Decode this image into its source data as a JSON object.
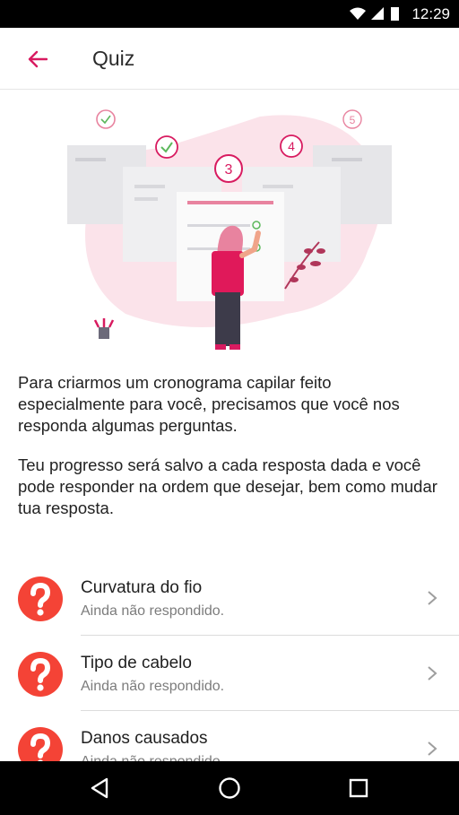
{
  "status_bar": {
    "time": "12:29"
  },
  "app_bar": {
    "title": "Quiz"
  },
  "hero": {
    "step_current": "3",
    "step_next": "4",
    "step_last": "5"
  },
  "intro": {
    "paragraph_1": "Para criarmos um cronograma capilar feito especialmente para você, precisamos que você nos responda algumas perguntas.",
    "paragraph_2": "Teu progresso será salvo a cada resposta dada e você pode responder na ordem que desejar, bem como mudar tua resposta."
  },
  "quiz_items": [
    {
      "title": "Curvatura do fio",
      "status": "Ainda não respondido."
    },
    {
      "title": "Tipo de cabelo",
      "status": "Ainda não respondido."
    },
    {
      "title": "Danos causados",
      "status": "Ainda não respondido."
    }
  ],
  "colors": {
    "accent": "#d81b60",
    "question_icon": "#f44336",
    "pink_soft": "#fbe3ea"
  }
}
